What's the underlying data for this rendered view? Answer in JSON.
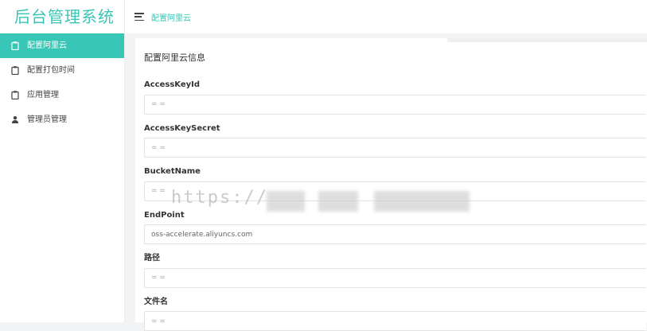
{
  "app": {
    "title": "后台管理系统"
  },
  "sidebar": {
    "items": [
      {
        "label": "配置阿里云",
        "icon": "clipboard-icon",
        "active": true
      },
      {
        "label": "配置打包时间",
        "icon": "clipboard-icon",
        "active": false
      },
      {
        "label": "应用管理",
        "icon": "clipboard-icon",
        "active": false
      },
      {
        "label": "管理员管理",
        "icon": "user-icon",
        "active": false
      }
    ]
  },
  "header": {
    "breadcrumb": "配置阿里云"
  },
  "form": {
    "title": "配置阿里云信息",
    "fields": [
      {
        "label": "AccessKeyId",
        "value": "",
        "placeholder": "= ="
      },
      {
        "label": "AccessKeySecret",
        "value": "",
        "placeholder": "= ="
      },
      {
        "label": "BucketName",
        "value": "",
        "placeholder": "= ="
      },
      {
        "label": "EndPoint",
        "value": "oss-accelerate.aliyuncs.com",
        "placeholder": ""
      },
      {
        "label": "路径",
        "value": "",
        "placeholder": "= ="
      },
      {
        "label": "文件名",
        "value": "",
        "placeholder": "= ="
      }
    ]
  },
  "watermark": "https://",
  "colors": {
    "accent": "#38c6b6"
  }
}
